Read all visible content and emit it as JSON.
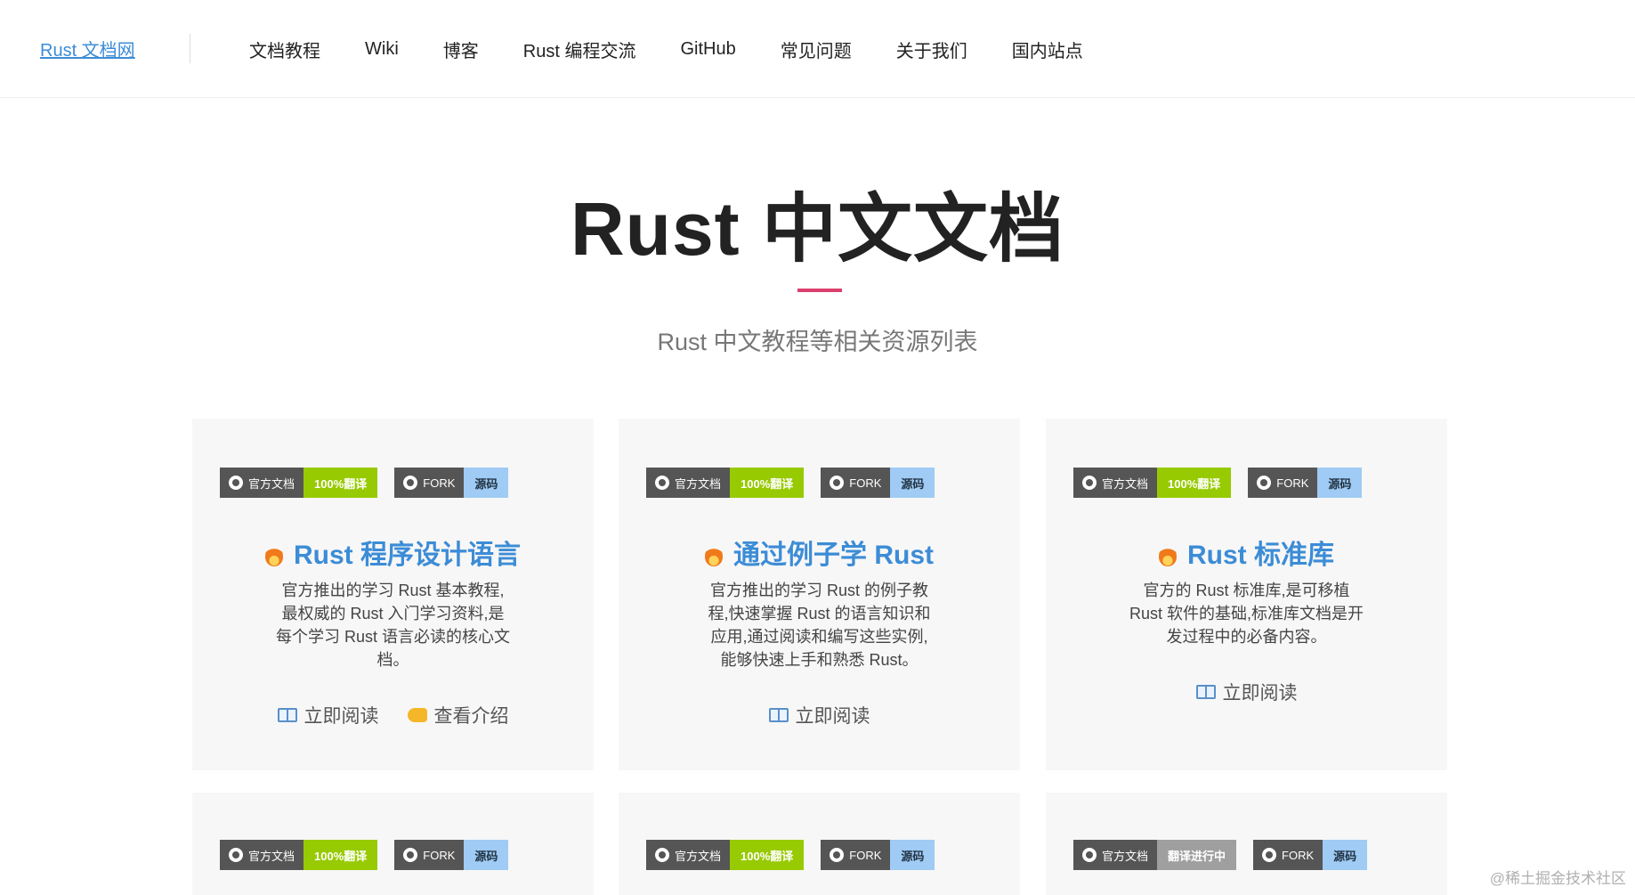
{
  "header": {
    "brand": "Rust 文档网",
    "nav": [
      "文档教程",
      "Wiki",
      "博客",
      "Rust 编程交流",
      "GitHub",
      "常见问题",
      "关于我们",
      "国内站点"
    ]
  },
  "hero": {
    "title": "Rust 中文文档",
    "subtitle": "Rust 中文教程等相关资源列表"
  },
  "badge_labels": {
    "official": "官方文档",
    "fork": "FORK",
    "source": "源码"
  },
  "cards": [
    {
      "status": "100%翻译",
      "title": "Rust 程序设计语言",
      "desc_lines": [
        "官方推出的学习 Rust 基本教程,",
        "最权威的 Rust 入门学习资料,是",
        "每个学习 Rust 语言必读的核心文",
        "档。"
      ],
      "links": [
        "立即阅读",
        "查看介绍"
      ]
    },
    {
      "status": "100%翻译",
      "title": "通过例子学 Rust",
      "desc_lines": [
        "官方推出的学习 Rust 的例子教",
        "程,快速掌握 Rust 的语言知识和",
        "应用,通过阅读和编写这些实例,",
        "能够快速上手和熟悉 Rust。"
      ],
      "links": [
        "立即阅读"
      ]
    },
    {
      "status": "100%翻译",
      "title": "Rust 标准库",
      "desc_lines": [
        "官方的 Rust 标准库,是可移植",
        "Rust 软件的基础,标准库文档是开",
        "发过程中的必备内容。"
      ],
      "links": [
        "立即阅读"
      ]
    },
    {
      "status": "100%翻译"
    },
    {
      "status": "100%翻译"
    },
    {
      "status": "翻译进行中"
    }
  ],
  "watermark": "@稀土掘金技术社区",
  "colors": {
    "brand_link": "#3c8cd6",
    "accent_bar": "#dc3f6c",
    "badge_dark": "#555555",
    "badge_green": "#97ca00",
    "badge_gray": "#9f9f9f",
    "badge_blue": "#9fcbf4",
    "card_bg": "#f7f7f7"
  }
}
